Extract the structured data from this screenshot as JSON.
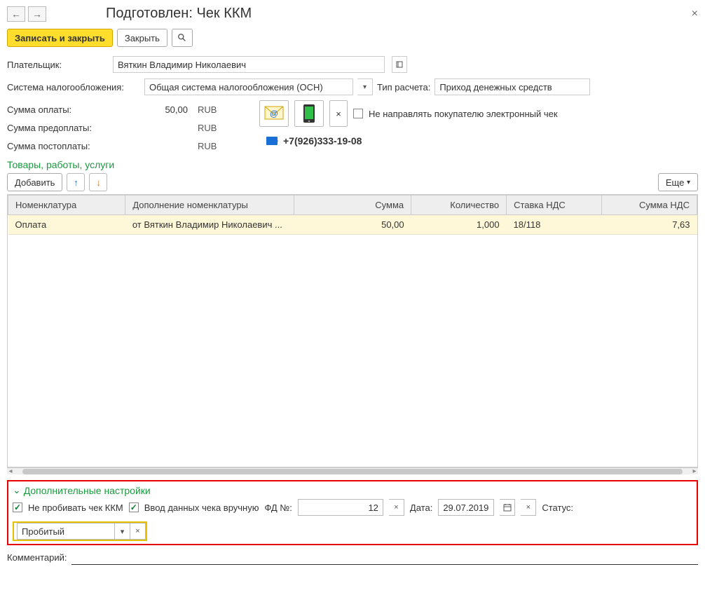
{
  "header": {
    "title": "Подготовлен: Чек ККМ"
  },
  "toolbar": {
    "save_close": "Записать и закрыть",
    "close": "Закрыть"
  },
  "form": {
    "payer_label": "Плательщик:",
    "payer_value": "Вяткин Владимир Николаевич",
    "tax_label": "Система налогообложения:",
    "tax_value": "Общая система налогообложения (ОСН)",
    "calc_label": "Тип расчета:",
    "calc_value": "Приход денежных средств",
    "sum_pay_label": "Сумма оплаты:",
    "sum_pay_value": "50,00",
    "sum_prepay_label": "Сумма предоплаты:",
    "sum_prepay_value": "",
    "sum_postpay_label": "Сумма постоплаты:",
    "sum_postpay_value": "",
    "currency": "RUB",
    "no_send_label": "Не направлять покупателю электронный чек",
    "phone": "+7(926)333-19-08"
  },
  "section": {
    "goods": "Товары, работы, услуги"
  },
  "table_toolbar": {
    "add": "Добавить",
    "more": "Еще"
  },
  "table": {
    "headers": {
      "nom": "Номенклатура",
      "dop": "Дополнение номенклатуры",
      "sum": "Сумма",
      "qty": "Количество",
      "vat": "Ставка НДС",
      "vsum": "Сумма НДС"
    },
    "rows": [
      {
        "nom": "Оплата",
        "dop": "от Вяткин Владимир Николаевич ...",
        "sum": "50,00",
        "qty": "1,000",
        "vat": "18/118",
        "vsum": "7,63"
      }
    ]
  },
  "additional": {
    "title": "Дополнительные настройки",
    "no_punch": "Не пробивать чек ККМ",
    "manual": "Ввод данных чека вручную",
    "fd_label": "ФД №:",
    "fd_value": "12",
    "date_label": "Дата:",
    "date_value": "29.07.2019",
    "status_label": "Статус:",
    "status_value": "Пробитый"
  },
  "comment": {
    "label": "Комментарий:",
    "value": ""
  }
}
